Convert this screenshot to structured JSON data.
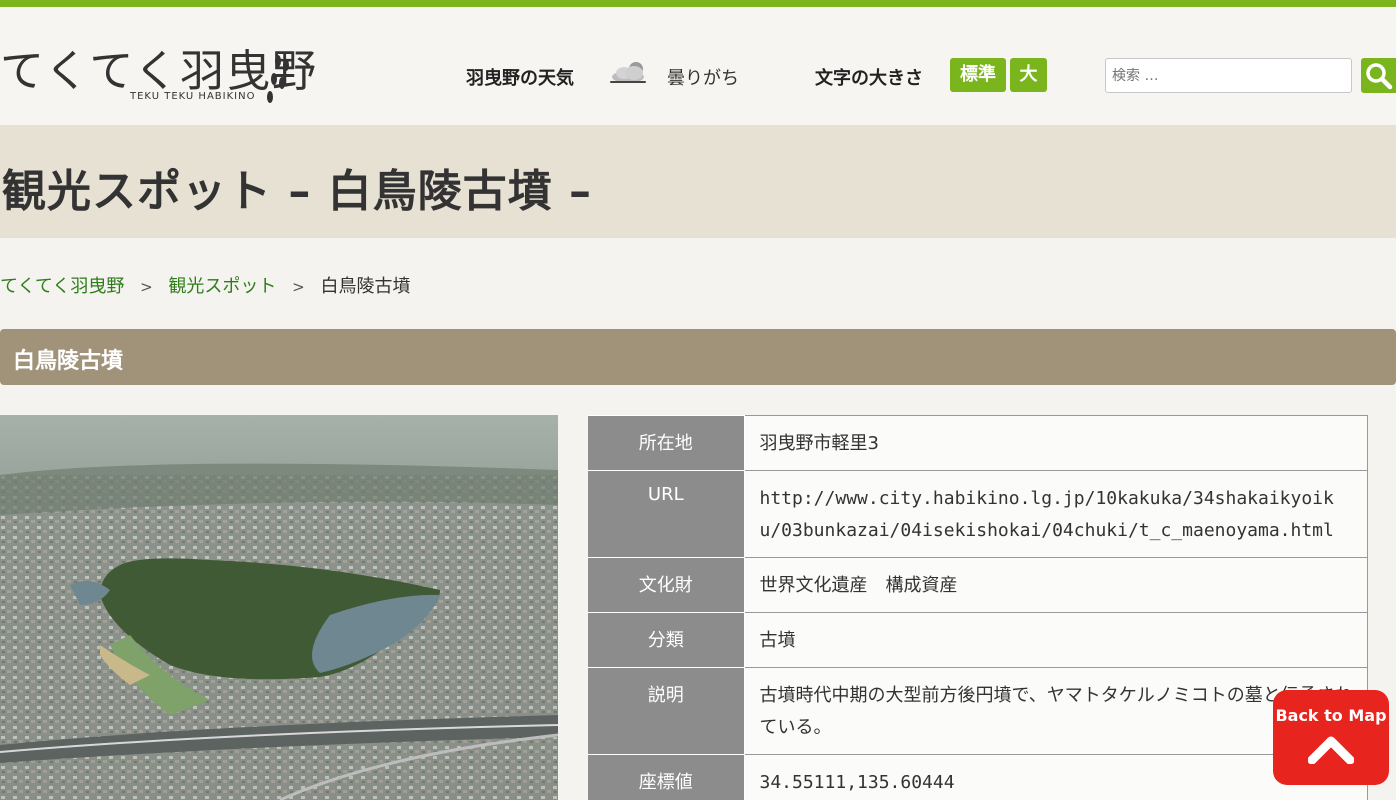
{
  "header": {
    "logo_text": "てくてく羽曳野",
    "logo_subtitle": "TEKU TEKU HABIKINO",
    "weather_label": "羽曳野の天気",
    "weather_icon": "cloudy-icon",
    "weather_text": "曇りがち",
    "fontsize_label": "文字の大きさ",
    "fontsize_normal": "標準",
    "fontsize_large": "大",
    "search_placeholder": "検索 …",
    "search_icon": "magnifier-icon"
  },
  "title": {
    "page_title": "観光スポット – 白鳥陵古墳 –"
  },
  "breadcrumb": {
    "items": [
      "てくてく羽曳野",
      "観光スポット"
    ],
    "separator": ">",
    "current": "白鳥陵古墳"
  },
  "section": {
    "title": "白鳥陵古墳"
  },
  "info": {
    "rows": [
      {
        "label": "所在地",
        "value": "羽曳野市軽里3"
      },
      {
        "label": "URL",
        "value": "http://www.city.habikino.lg.jp/10kakuka/34shakaikyoiku/03bunkazai/04isekishokai/04chuki/t_c_maenoyama.html"
      },
      {
        "label": "文化財",
        "value": "世界文化遺産　構成資産"
      },
      {
        "label": "分類",
        "value": "古墳"
      },
      {
        "label": "説明",
        "value": "古墳時代中期の大型前方後円墳で、ヤマトタケルノミコトの墓と伝承されている。"
      },
      {
        "label": "座標値",
        "value": "34.55111,135.60444"
      }
    ]
  },
  "back_to_map": {
    "label": "Back to Map",
    "icon": "chevron-up-icon"
  },
  "colors": {
    "accent": "#7ab51d",
    "section_bar": "#a09379",
    "title_band": "#e6e1d3",
    "table_header": "#8c8c8c",
    "back_button": "#e8241e",
    "link": "#2e7d1a"
  }
}
